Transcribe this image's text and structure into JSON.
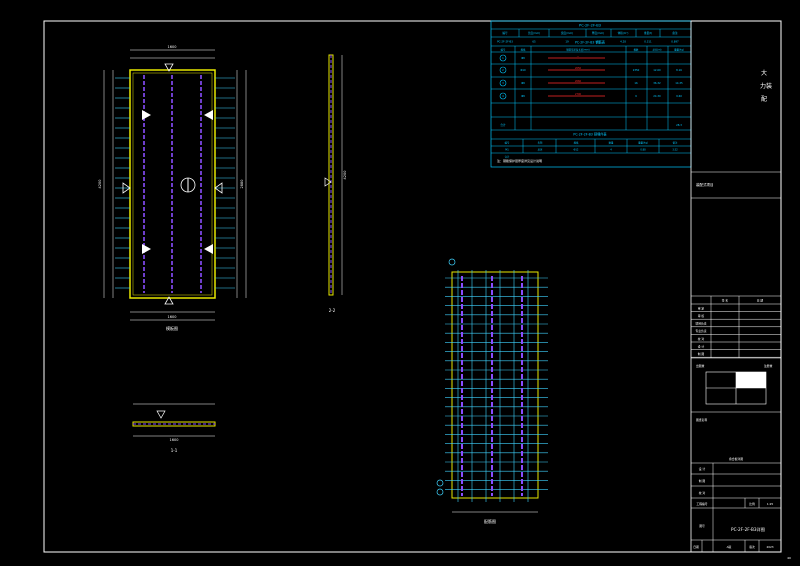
{
  "colors": {
    "background": "#000000",
    "frame": "#ffffff",
    "panel_outline": "#e8e800",
    "rebar_vertical": "#8a4dff",
    "rebar_horizontal": "#3fd4ff",
    "dimension": "#ffffff",
    "table_line": "#00c8ff",
    "table_highlight": "#ff2a2a",
    "title_block": "#ffffff"
  },
  "table": {
    "header_title": "PC-2F-2F-B3",
    "columns": [
      "编号",
      "长度(mm)",
      "宽度(mm)",
      "厚度(mm)",
      "体积(m³)",
      "重量(t)",
      "备注"
    ],
    "row_main": [
      "PC-2F-2F-B3",
      "65",
      "19",
      "90",
      "4.28",
      "0.311",
      "0.897"
    ],
    "sub_title_1": "PC-2F-2F-B3 钢筋表",
    "rebar_columns": [
      "编号",
      "规格",
      "钢筋形状及长度(mm)",
      "根数",
      "总长(m)",
      "重量(kg)"
    ],
    "rebar_rows": [
      {
        "id": "1",
        "spec": "Φ8",
        "shape": "—",
        "count": "",
        "len": "",
        "wt": ""
      },
      {
        "id": "2",
        "spec": "Φ10",
        "shape": "2050",
        "count": "2350",
        "len": "12.60",
        "wt": "8.16"
      },
      {
        "id": "3",
        "spec": "Φ8",
        "shape": "2060",
        "count": "16",
        "len": "36.32",
        "wt": "14.35"
      },
      {
        "id": "4",
        "spec": "Φ8",
        "shape": "2700",
        "count": "9",
        "len": "24.30",
        "wt": "9.60"
      }
    ],
    "total_label": "合计",
    "total_value": "28.3",
    "sub_title_2": "PC-2F-2F-B3 预埋件表",
    "embed_columns": [
      "编号",
      "名称",
      "规格",
      "数量",
      "重量(kg)",
      "备注"
    ],
    "embed_row": [
      "M1",
      "吊环",
      "Φ12",
      "4",
      "0.88",
      "3.52"
    ],
    "embed_total": "合计",
    "footnote": "注：钢筋保护层厚度详见设计说明"
  },
  "labels": {
    "plan_view": "模板图",
    "section_2": "2-2",
    "section_1": "1-1",
    "rebar_plan": "配筋图",
    "dim_width_top": "1600",
    "dim_height": "4200",
    "dim_inner_height": "2880",
    "dim_bottom": "1600",
    "dim_section_len": "4200",
    "dim_section_w": "1600",
    "mark_1": "1",
    "mark_2": "2",
    "mark_3": "3",
    "mark_4": "4"
  },
  "title_block": {
    "side_text": [
      "大",
      "力装",
      "配"
    ],
    "project": "装配式项目",
    "rows": [
      "审 定",
      "审 核",
      "项目负责",
      "专业负责",
      "校 对",
      "设 计",
      "制 图"
    ],
    "col_headers": [
      "签 名",
      "日 期"
    ],
    "stamp_label": "出图章",
    "seal_label": "注册章",
    "sheet_label": "图纸名称",
    "sheet_sub": "叠合板详图",
    "proj_no_label": "工程编号",
    "scale_label": "比例",
    "scale_value": "1:25",
    "dwg_label": "图号",
    "drawing_name": "PC-2F-2F-B3详图",
    "date_label": "日期",
    "sheet_label2": "版次",
    "date_value": "2023",
    "version_value": "A版",
    "page": "40"
  }
}
